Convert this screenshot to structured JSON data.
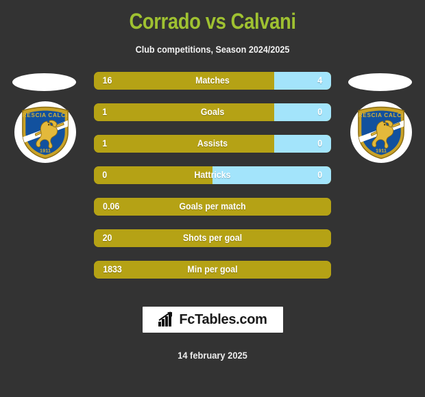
{
  "header": {
    "title": "Corrado vs Calvani",
    "subtitle": "Club competitions, Season 2024/2025",
    "title_color": "#9fc131"
  },
  "teams": {
    "home": {
      "crest_name": "brescia-calcio-crest",
      "crest_top_text": "BRESCIA CALCIO",
      "crest_year": "1911"
    },
    "away": {
      "crest_name": "brescia-calcio-crest",
      "crest_top_text": "BRESCIA CALCIO",
      "crest_year": "1911"
    }
  },
  "colors": {
    "background": "#333333",
    "home_bar": "#b5a215",
    "away_bar": "#a3e4fb",
    "text": "#ffffff"
  },
  "chart_data": {
    "type": "bar",
    "title": "Corrado vs Calvani",
    "subtitle": "Club competitions, Season 2024/2025",
    "orientation": "horizontal-diverging",
    "categories": [
      "Matches",
      "Goals",
      "Assists",
      "Hattricks",
      "Goals per match",
      "Shots per goal",
      "Min per goal"
    ],
    "series": [
      {
        "name": "Corrado",
        "values": [
          "16",
          "1",
          "1",
          "0",
          "0.06",
          "20",
          "1833"
        ]
      },
      {
        "name": "Calvani",
        "values": [
          "4",
          "0",
          "0",
          "0",
          null,
          null,
          null
        ]
      }
    ],
    "rows": [
      {
        "label": "Matches",
        "home": "16",
        "away": "4",
        "home_pct": 76,
        "split": true
      },
      {
        "label": "Goals",
        "home": "1",
        "away": "0",
        "home_pct": 76,
        "split": true
      },
      {
        "label": "Assists",
        "home": "1",
        "away": "0",
        "home_pct": 76,
        "split": true
      },
      {
        "label": "Hattricks",
        "home": "0",
        "away": "0",
        "home_pct": 50,
        "split": true
      },
      {
        "label": "Goals per match",
        "home": "0.06",
        "away": "",
        "home_pct": 100,
        "split": false
      },
      {
        "label": "Shots per goal",
        "home": "20",
        "away": "",
        "home_pct": 100,
        "split": false
      },
      {
        "label": "Min per goal",
        "home": "1833",
        "away": "",
        "home_pct": 100,
        "split": false
      }
    ]
  },
  "footer": {
    "brand": "FcTables.com",
    "brand_icon": "bar-chart-arrow-icon",
    "date": "14 february 2025"
  }
}
